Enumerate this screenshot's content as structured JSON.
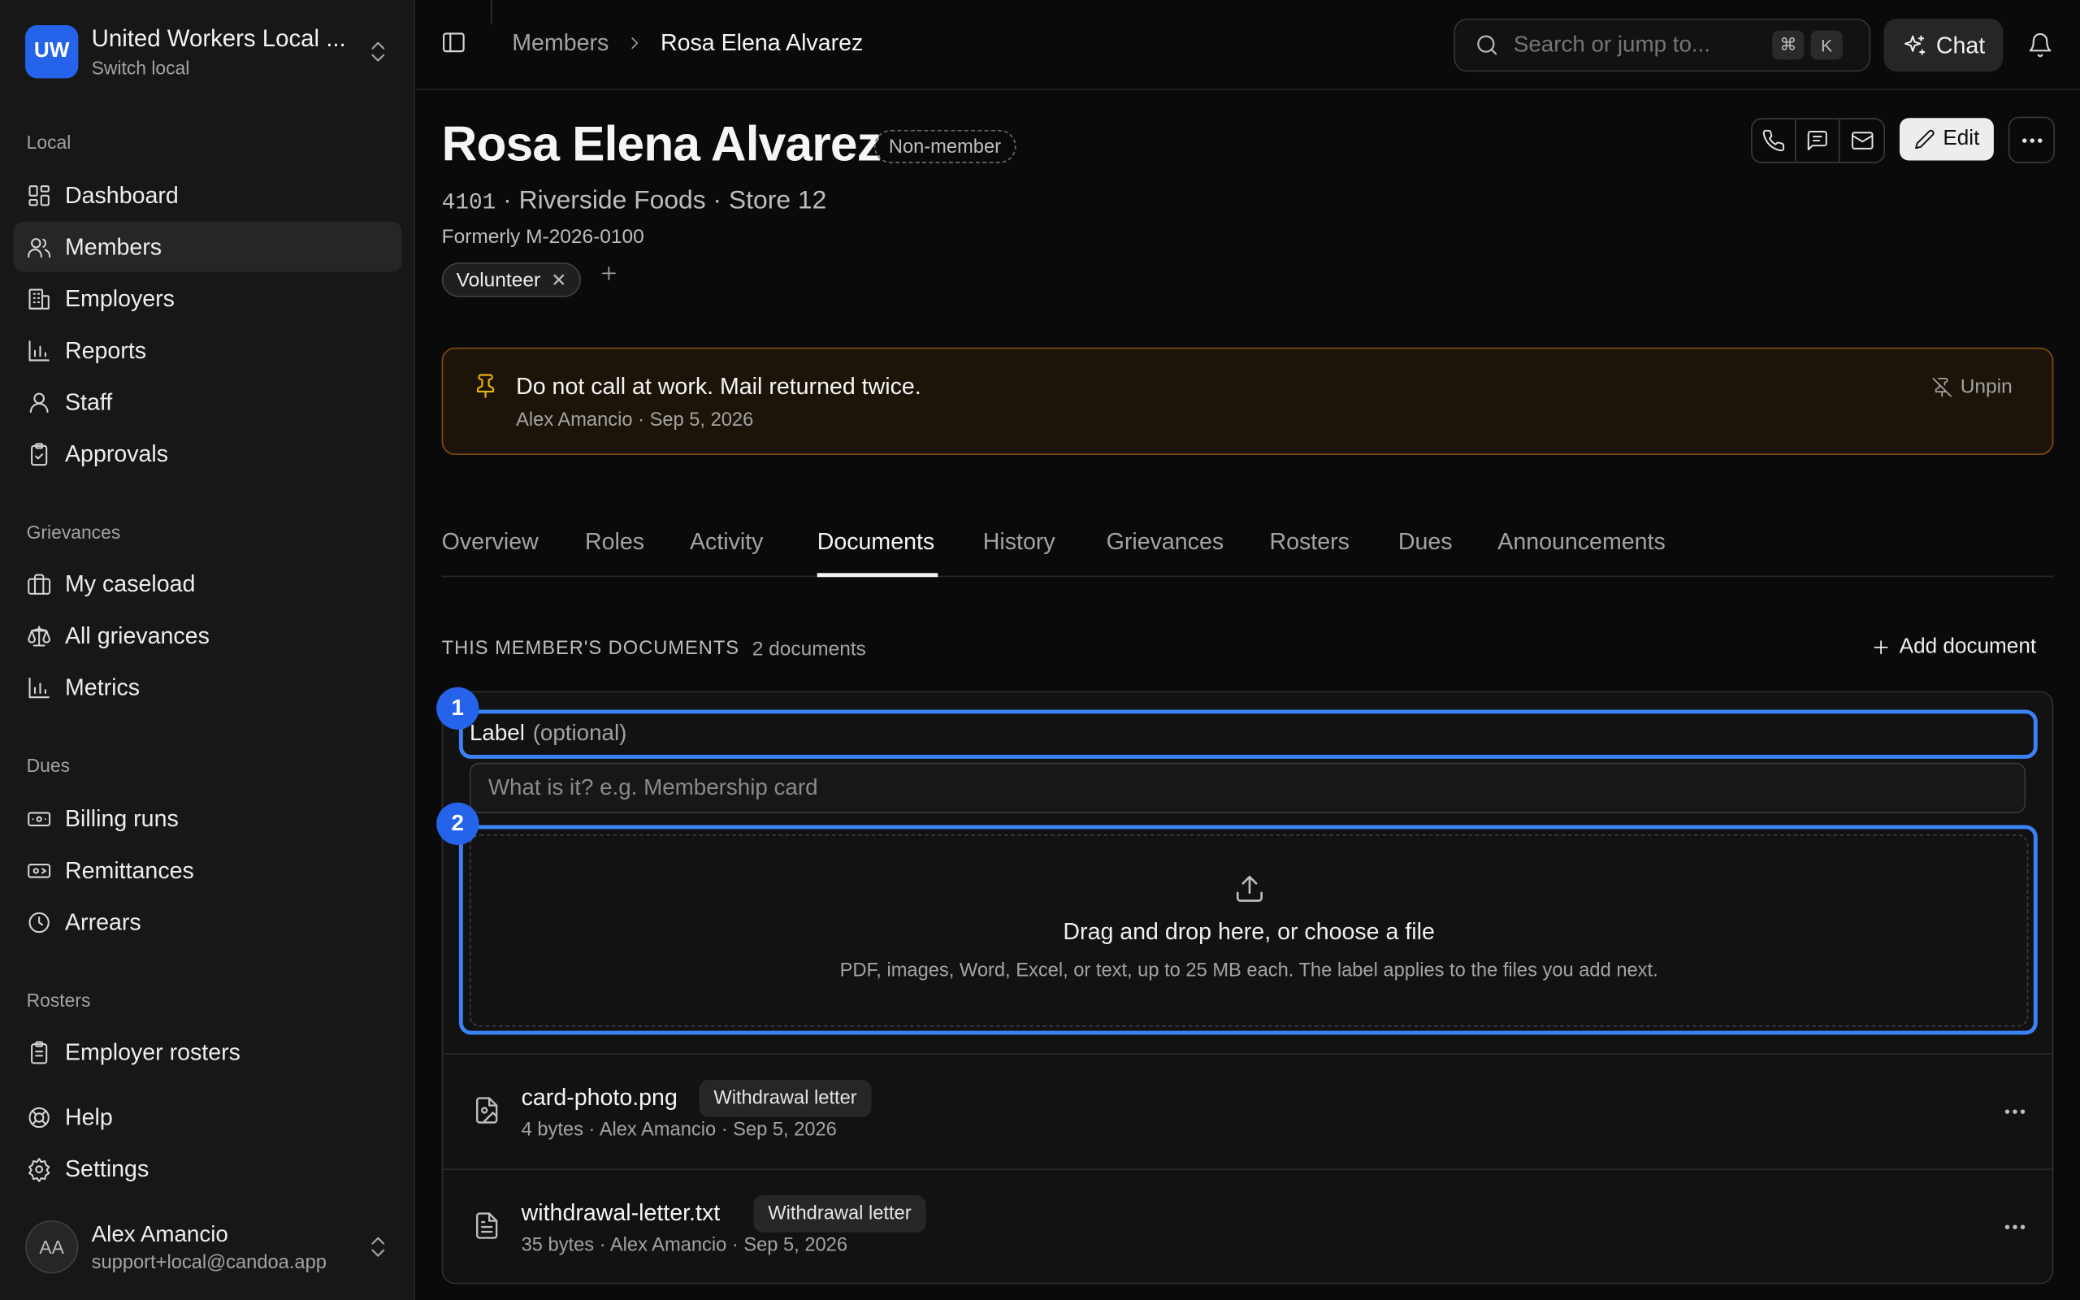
{
  "org": {
    "initials": "UW",
    "name": "United Workers Local ...",
    "switch_label": "Switch local"
  },
  "sidebar": {
    "sections": [
      {
        "title": "Local",
        "items": [
          "Dashboard",
          "Members",
          "Employers",
          "Reports",
          "Staff",
          "Approvals"
        ]
      },
      {
        "title": "Grievances",
        "items": [
          "My caseload",
          "All grievances",
          "Metrics"
        ]
      },
      {
        "title": "Dues",
        "items": [
          "Billing runs",
          "Remittances",
          "Arrears"
        ]
      },
      {
        "title": "Rosters",
        "items": [
          "Employer rosters"
        ]
      }
    ],
    "help": "Help",
    "settings": "Settings",
    "active_item": "Members"
  },
  "user": {
    "initials": "AA",
    "name": "Alex Amancio",
    "email": "support+local@candoa.app"
  },
  "topbar": {
    "breadcrumb_parent": "Members",
    "breadcrumb_current": "Rosa Elena Alvarez",
    "search_placeholder": "Search or jump to...",
    "kbd_cmd": "⌘",
    "kbd_k": "K",
    "chat_label": "Chat"
  },
  "member": {
    "name": "Rosa Elena Alvarez",
    "status": "Non-member",
    "id": "4101",
    "employer_line": "Riverside Foods · Store 12",
    "formerly": "Formerly M-2026-0100",
    "tags": [
      "Volunteer"
    ],
    "edit_label": "Edit"
  },
  "pinned_note": {
    "text": "Do not call at work. Mail returned twice.",
    "meta": "Alex Amancio · Sep 5, 2026",
    "unpin_label": "Unpin"
  },
  "tabs": [
    "Overview",
    "Roles",
    "Activity",
    "Documents",
    "History",
    "Grievances",
    "Rosters",
    "Dues",
    "Announcements"
  ],
  "active_tab": "Documents",
  "documents": {
    "heading": "THIS MEMBER'S DOCUMENTS",
    "count": "2 documents",
    "add_label": "Add document",
    "label_field": {
      "label": "Label",
      "optional": "(optional)",
      "placeholder": "What is it? e.g. Membership card"
    },
    "dropzone": {
      "title": "Drag and drop here, or choose a file",
      "subtitle": "PDF, images, Word, Excel, or text, up to 25 MB each. The label applies to the files you add next."
    },
    "markers": [
      "1",
      "2"
    ],
    "items": [
      {
        "name": "card-photo.png",
        "tag": "Withdrawal letter",
        "meta": "4 bytes · Alex Amancio · Sep 5, 2026",
        "icon": "image-file-icon"
      },
      {
        "name": "withdrawal-letter.txt",
        "tag": "Withdrawal letter",
        "meta": "35 bytes · Alex Amancio · Sep 5, 2026",
        "icon": "text-file-icon"
      }
    ]
  },
  "colors": {
    "accent": "#2563eb",
    "highlight": "#3b82f6",
    "note_border": "#854d0e",
    "pin": "#eab308"
  }
}
